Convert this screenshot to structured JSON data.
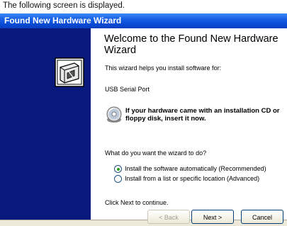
{
  "caption": "The following screen is displayed.",
  "window": {
    "title": "Found New Hardware Wizard"
  },
  "wizard": {
    "heading": "Welcome to the Found New Hardware Wizard",
    "intro": "This wizard helps you install software for:",
    "device": "USB Serial Port",
    "cd_notice": "If your hardware came with an installation CD or floppy disk, insert it now.",
    "question": "What do you want the wizard to do?",
    "options": [
      {
        "label": "Install the software automatically (Recommended)",
        "selected": true
      },
      {
        "label": "Install from a list or specific location (Advanced)",
        "selected": false
      }
    ],
    "continue_hint": "Click Next to continue."
  },
  "buttons": {
    "back": "< Back",
    "next": "Next >",
    "cancel": "Cancel"
  },
  "colors": {
    "sidebar": "#08197c",
    "titlebar": "#0a4bd6",
    "radio_dot": "#21a121"
  },
  "icons": [
    "hardware-wizard-icon",
    "cd-icon"
  ]
}
